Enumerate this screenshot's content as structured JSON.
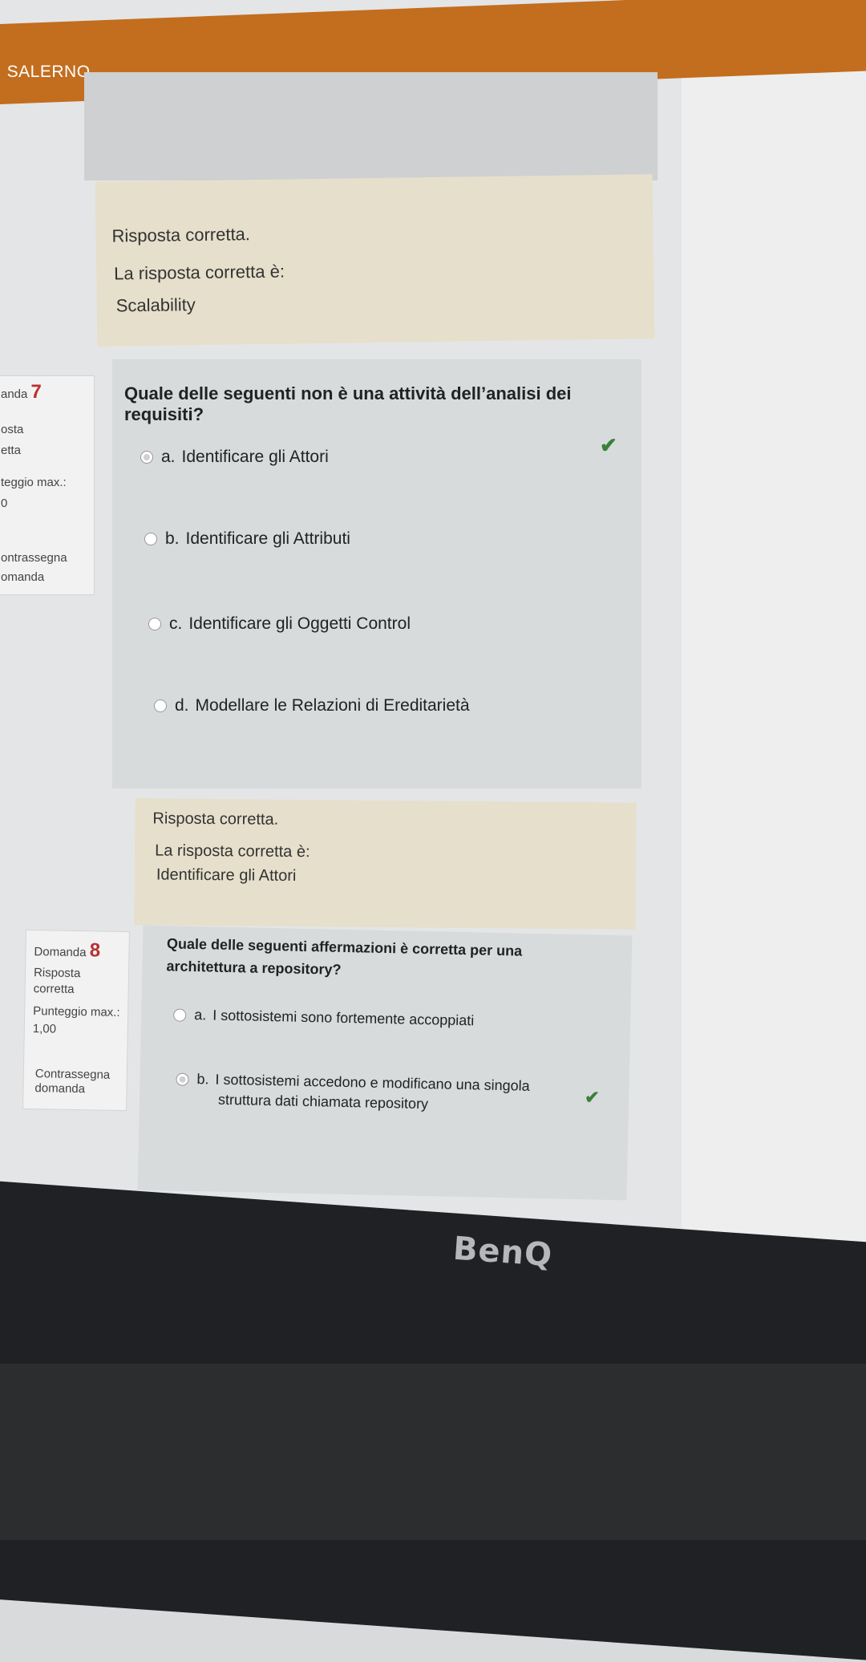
{
  "header": {
    "brand": "I SALERNO"
  },
  "feedback_prev": {
    "status": "Risposta corretta.",
    "label": "La risposta corretta è:",
    "answer": "Scalability"
  },
  "question7": {
    "number_prefix": "anda",
    "number": "7",
    "info": [
      "osta",
      "etta",
      "teggio max.:",
      "0",
      "ontrassegna",
      "omanda"
    ],
    "text": "Quale delle seguenti non è una attività dell’analisi dei requisiti?",
    "options": [
      {
        "letter": "a.",
        "label": "Identificare gli Attori",
        "selected": true,
        "correct": true
      },
      {
        "letter": "b.",
        "label": "Identificare gli Attributi",
        "selected": false,
        "correct": false
      },
      {
        "letter": "c.",
        "label": "Identificare gli Oggetti Control",
        "selected": false,
        "correct": false
      },
      {
        "letter": "d.",
        "label": "Modellare le Relazioni di Ereditarietà",
        "selected": false,
        "correct": false
      }
    ],
    "feedback": {
      "status": "Risposta corretta.",
      "label": "La risposta corretta è:",
      "answer": "Identificare gli Attori"
    }
  },
  "question8": {
    "number_prefix": "Domanda",
    "number": "8",
    "info": [
      "Risposta",
      "corretta",
      "Punteggio max.:",
      "1,00",
      "Contrassegna",
      "domanda"
    ],
    "text_line1": "Quale delle seguenti affermazioni è corretta per una",
    "text_line2": "architettura a repository?",
    "options": [
      {
        "letter": "a.",
        "label": "I sottosistemi sono fortemente accoppiati",
        "selected": false
      },
      {
        "letter": "b.",
        "label": "I sottosistemi accedono e modificano una singola",
        "label2": "struttura dati chiamata repository",
        "selected": true,
        "correct": true
      }
    ]
  },
  "monitor": {
    "brand": "BenQ"
  },
  "colors": {
    "topbar": "#c26e1e",
    "feedback": "#e6dfcb",
    "question_bg": "#d7dbdb",
    "check": "#3b7f3b",
    "flag": "#b8312f"
  }
}
